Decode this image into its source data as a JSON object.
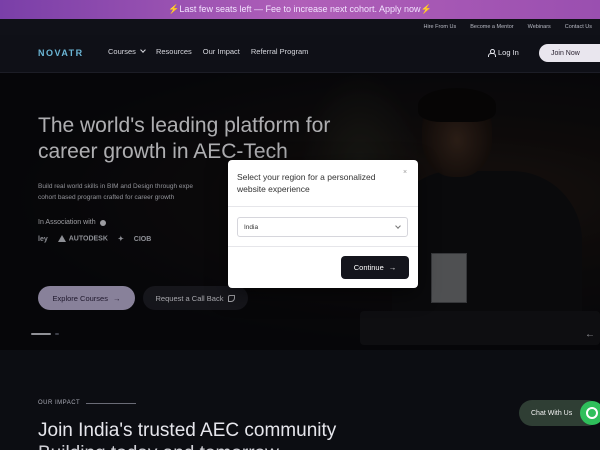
{
  "announcement": {
    "text": "⚡Last few seats left — Fee to increase next cohort. Apply now⚡"
  },
  "topbar": {
    "links": [
      "Hire From Us",
      "Become a Mentor",
      "Webinars",
      "Contact Us"
    ]
  },
  "nav": {
    "logo": "NOVATR",
    "links": [
      "Courses",
      "Resources",
      "Our Impact",
      "Referral Program"
    ],
    "login": "Log In",
    "join": "Join Now"
  },
  "hero": {
    "title_line1": "The world's leading platform for",
    "title_line2": "career growth in AEC-Tech",
    "subtitle_line1": "Build real world skills in BIM and Design through expe",
    "subtitle_line2": "cohort based program crafted for career growth",
    "association": "In Association with",
    "partners": [
      "ley",
      "AUTODESK",
      "",
      "CIOB"
    ],
    "explore_button": "Explore Courses",
    "call_button": "Request a Call Back"
  },
  "modal": {
    "title": "Select your region for a personalized website experience",
    "close": "×",
    "region_value": "India",
    "continue_button": "Continue"
  },
  "impact": {
    "label": "OUR IMPACT",
    "heading_line1": "Join India's trusted AEC community",
    "heading_line2": "Building today and tomorrow"
  },
  "chat": {
    "label": "Chat With Us"
  }
}
